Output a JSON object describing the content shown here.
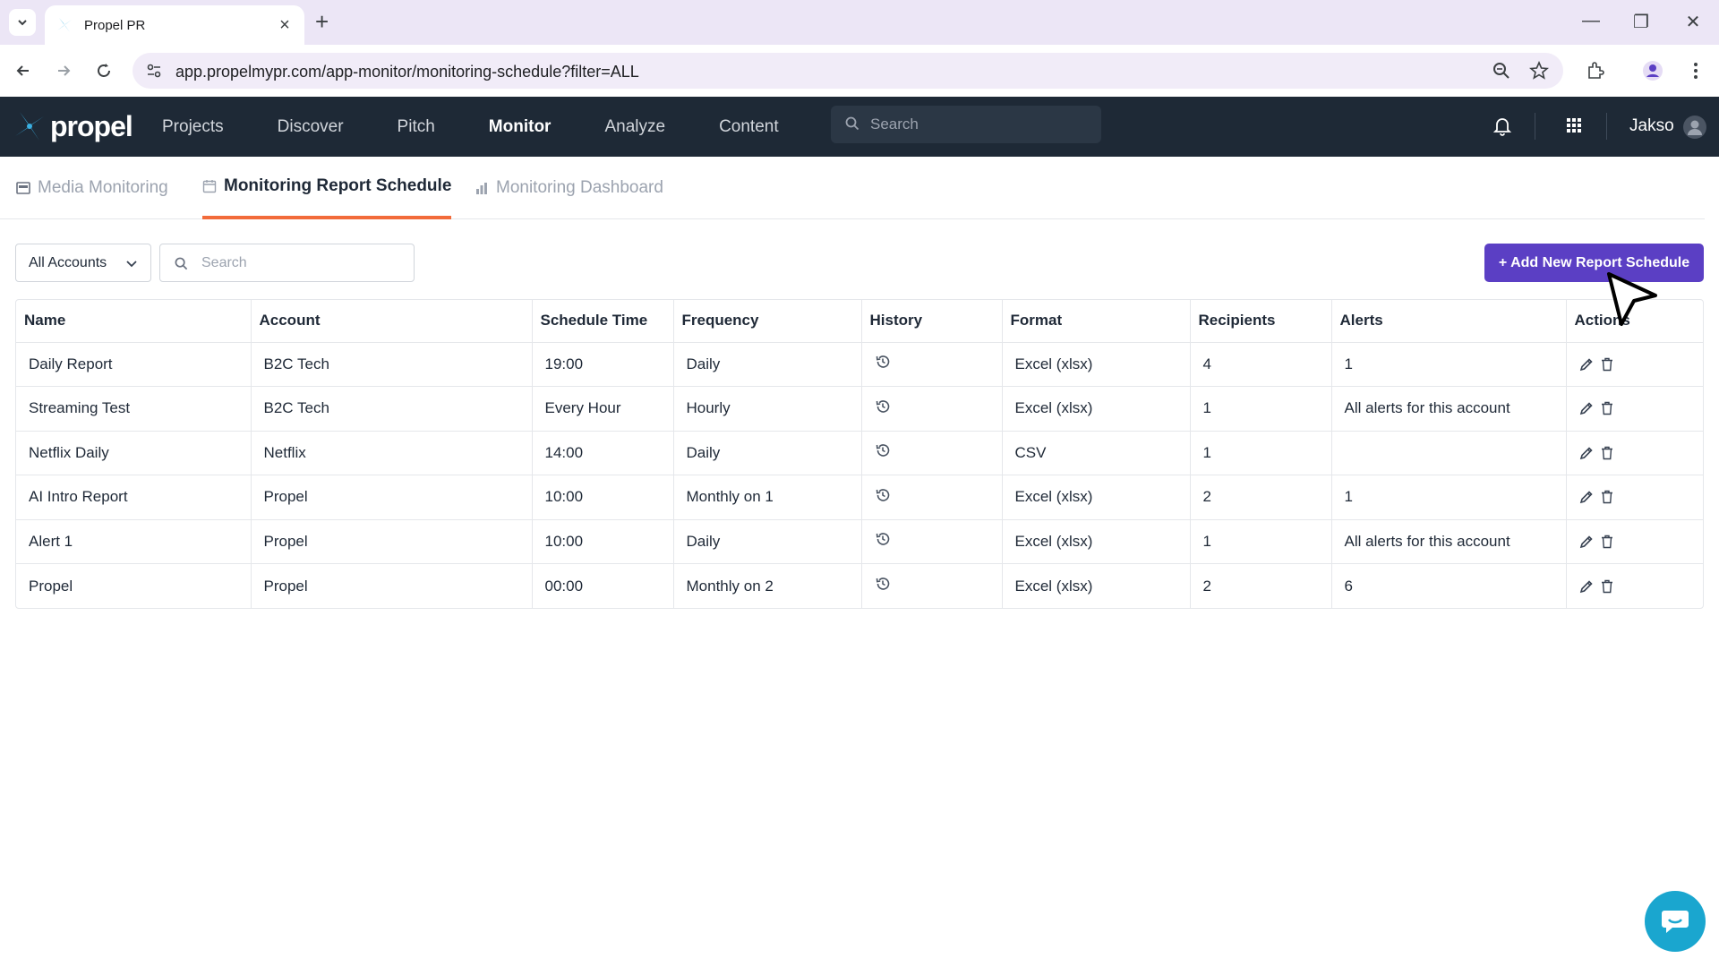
{
  "browser": {
    "tab_title": "Propel PR",
    "url": "app.propelmypr.com/app-monitor/monitoring-schedule?filter=ALL"
  },
  "app": {
    "logo_text": "propel",
    "nav": [
      "Projects",
      "Discover",
      "Pitch",
      "Monitor",
      "Analyze",
      "Content"
    ],
    "active_nav": "Monitor",
    "search_placeholder": "Search",
    "username": "Jakso"
  },
  "subtabs": {
    "media_monitoring": "Media Monitoring",
    "report_schedule": "Monitoring Report Schedule",
    "dashboard": "Monitoring Dashboard"
  },
  "controls": {
    "account_filter": "All Accounts",
    "search_placeholder": "Search",
    "add_button": "+ Add New Report Schedule"
  },
  "table": {
    "columns": [
      "Name",
      "Account",
      "Schedule Time",
      "Frequency",
      "History",
      "Format",
      "Recipients",
      "Alerts",
      "Actions"
    ],
    "rows": [
      {
        "name": "Daily Report",
        "account": "B2C Tech",
        "time": "19:00",
        "frequency": "Daily",
        "format": "Excel (xlsx)",
        "recipients": "4",
        "alerts": "1"
      },
      {
        "name": "Streaming Test",
        "account": "B2C Tech",
        "time": "Every Hour",
        "frequency": "Hourly",
        "format": "Excel (xlsx)",
        "recipients": "1",
        "alerts": "All alerts for this account"
      },
      {
        "name": "Netflix Daily",
        "account": "Netflix",
        "time": "14:00",
        "frequency": "Daily",
        "format": "CSV",
        "recipients": "1",
        "alerts": ""
      },
      {
        "name": "AI Intro Report",
        "account": "Propel",
        "time": "10:00",
        "frequency": "Monthly on 1",
        "format": "Excel (xlsx)",
        "recipients": "2",
        "alerts": "1"
      },
      {
        "name": "Alert 1",
        "account": "Propel",
        "time": "10:00",
        "frequency": "Daily",
        "format": "Excel (xlsx)",
        "recipients": "1",
        "alerts": "All alerts for this account"
      },
      {
        "name": "Propel",
        "account": "Propel",
        "time": "00:00",
        "frequency": "Monthly on 2",
        "format": "Excel (xlsx)",
        "recipients": "2",
        "alerts": "6"
      }
    ]
  },
  "colors": {
    "appbar": "#1e2936",
    "accent_button": "#5b3fc4",
    "active_tab_underline": "#f26b3a",
    "chat": "#1aa6cf"
  }
}
